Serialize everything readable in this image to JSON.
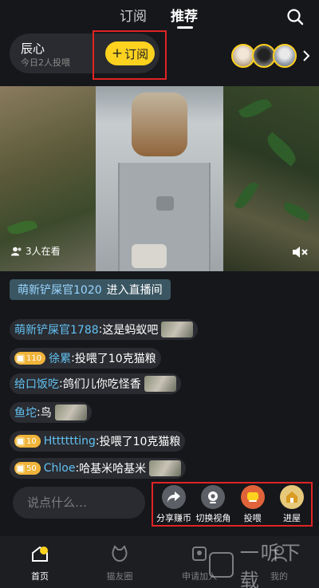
{
  "top_tabs": {
    "subscribed": "订阅",
    "recommended": "推荐"
  },
  "streamer": {
    "name": "辰心",
    "subtitle": "今日2人投喂",
    "subscribe_label": "订阅"
  },
  "video": {
    "viewers": "3人在看"
  },
  "enter_banner": {
    "user": "萌新铲屎官1020",
    "action": "进入直播间"
  },
  "chat": [
    {
      "user": "萌新铲屎官1788",
      "text": "这是蚂蚁吧",
      "thumb": true
    },
    {
      "level": "110",
      "user": "徐累",
      "text": "投喂了10克猫粮"
    },
    {
      "user": "给口饭吃",
      "text": "鸽们儿你吃怪香",
      "thumb": true
    },
    {
      "user": "鱼坨",
      "text": "鸟",
      "thumb": true
    },
    {
      "level": "10",
      "user": "Htttttting",
      "text": "投喂了10克猫粮"
    },
    {
      "level": "50",
      "user": "Chloe",
      "text": "哈基米哈基米",
      "thumb": true
    }
  ],
  "comment_input": {
    "placeholder": "说点什么…"
  },
  "actions": {
    "share": "分享赚币",
    "switch_view": "切换视角",
    "feed": "投喂",
    "enter_room": "进屋"
  },
  "bottom_nav": {
    "home": "首页",
    "cat_circle": "猫友圈",
    "apply": "申请加入",
    "mine": "我的"
  },
  "watermark": {
    "text": "一听下载"
  },
  "colors": {
    "accent": "#ffd21f",
    "username": "#62c1f2",
    "highlight": "#e02424"
  }
}
